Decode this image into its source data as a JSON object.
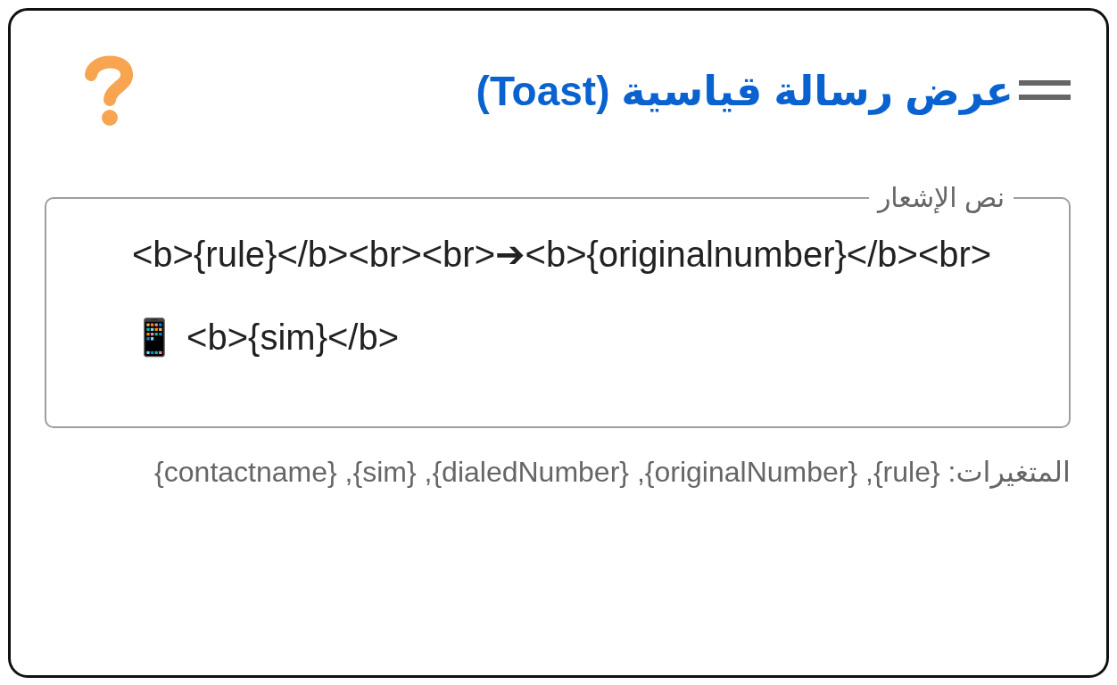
{
  "card": {
    "title": "عرض رسالة قياسية (Toast)",
    "field": {
      "label": "نص الإشعار",
      "value": "<b>{rule}</b><br><br>➔<b>{originalnumber}</b><br>📱 <b>{sim}</b>"
    },
    "helper": "المتغيرات: {rule}, {originalNumber}, {dialedNumber}, {sim}, {contactname}"
  }
}
